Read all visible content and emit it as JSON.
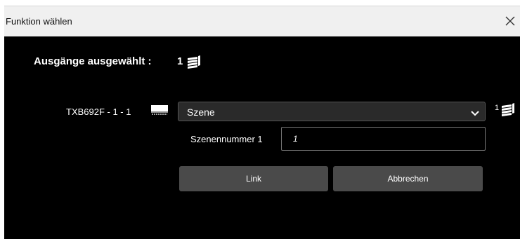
{
  "dialog": {
    "title": "Funktion wählen"
  },
  "selection": {
    "label": "Ausgänge ausgewählt :",
    "count": "1"
  },
  "device": {
    "label": "TXB692F - 1 - 1"
  },
  "function_select": {
    "value": "Szene",
    "count": "1"
  },
  "scene": {
    "label": "Szenennummer 1",
    "value": "1"
  },
  "buttons": {
    "link": "Link",
    "cancel": "Abbrechen"
  },
  "colors": {
    "background": "#000000",
    "titlebar": "#f0f0f0",
    "button": "#4a4a4a",
    "select": "#2a2a2a"
  },
  "icons": {
    "close": "close-icon",
    "outputs": "stack-outputs-icon",
    "device": "shutter-device-icon",
    "chevron": "chevron-down-icon"
  }
}
